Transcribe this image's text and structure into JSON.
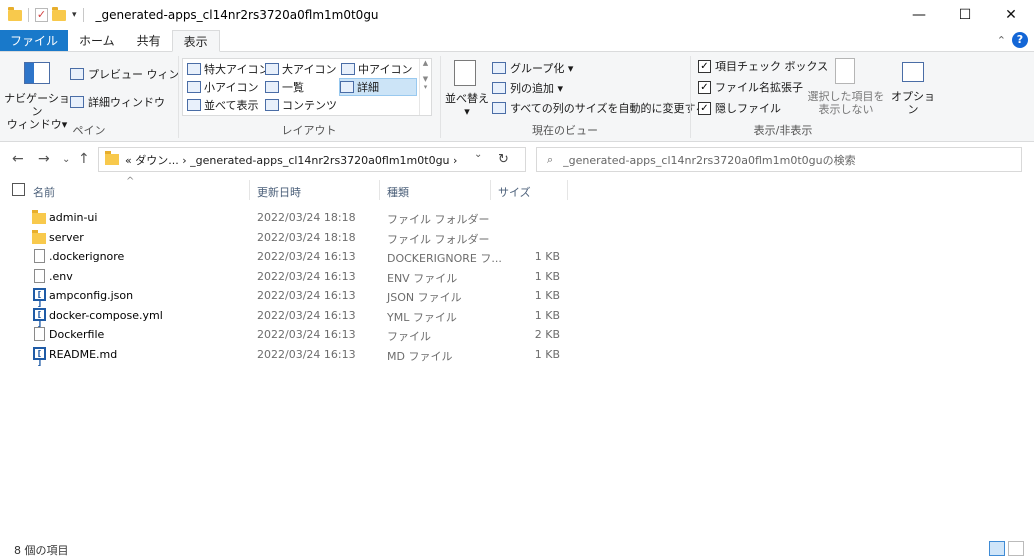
{
  "window": {
    "title": "_generated-apps_cl14nr2rs3720a0flm1m0t0gu",
    "controls": {
      "minimize": "—",
      "maximize": "☐",
      "close": "✕"
    }
  },
  "ribbon_tabs": [
    "ファイル",
    "ホーム",
    "共有",
    "表示"
  ],
  "ribbon": {
    "pane": {
      "nav_pane_label_1": "ナビゲーション",
      "nav_pane_label_2": "ウィンドウ▾",
      "preview": "プレビュー ウィンドウ",
      "details": "詳細ウィンドウ",
      "group_label": "ペイン"
    },
    "layout": {
      "items": [
        "特大アイコン",
        "大アイコン",
        "中アイコン",
        "小アイコン",
        "一覧",
        "詳細",
        "並べて表示",
        "コンテンツ"
      ],
      "selected": "詳細",
      "group_label": "レイアウト"
    },
    "current_view": {
      "sort_label_1": "並べ替え",
      "sort_label_2": "▾",
      "group_by": "グループ化 ▾",
      "add_column": "列の追加 ▾",
      "fit_columns": "すべての列のサイズを自動的に変更する",
      "group_label": "現在のビュー"
    },
    "show_hide": {
      "item_checkbox": "項目チェック ボックス",
      "file_ext": "ファイル名拡張子",
      "hidden_files": "隠しファイル",
      "hide_selected_1": "選択した項目を",
      "hide_selected_2": "表示しない",
      "options": "オプション",
      "group_label": "表示/非表示"
    }
  },
  "address": {
    "path": "« ダウン...  ›  _generated-apps_cl14nr2rs3720a0flm1m0t0gu  ›",
    "search_placeholder": "_generated-apps_cl14nr2rs3720a0flm1m0t0guの検索"
  },
  "columns": {
    "name": "名前",
    "modified": "更新日時",
    "type": "種類",
    "size": "サイズ"
  },
  "files": [
    {
      "name": "admin-ui",
      "modified": "2022/03/24 18:18",
      "type": "ファイル フォルダー",
      "size": "",
      "icon": "folder"
    },
    {
      "name": "server",
      "modified": "2022/03/24 18:18",
      "type": "ファイル フォルダー",
      "size": "",
      "icon": "folder"
    },
    {
      "name": ".dockerignore",
      "modified": "2022/03/24 16:13",
      "type": "DOCKERIGNORE フ...",
      "size": "1 KB",
      "icon": "doc"
    },
    {
      "name": ".env",
      "modified": "2022/03/24 16:13",
      "type": "ENV ファイル",
      "size": "1 KB",
      "icon": "doc"
    },
    {
      "name": "ampconfig.json",
      "modified": "2022/03/24 16:13",
      "type": "JSON ファイル",
      "size": "1 KB",
      "icon": "code"
    },
    {
      "name": "docker-compose.yml",
      "modified": "2022/03/24 16:13",
      "type": "YML ファイル",
      "size": "1 KB",
      "icon": "code"
    },
    {
      "name": "Dockerfile",
      "modified": "2022/03/24 16:13",
      "type": "ファイル",
      "size": "2 KB",
      "icon": "doc"
    },
    {
      "name": "README.md",
      "modified": "2022/03/24 16:13",
      "type": "MD ファイル",
      "size": "1 KB",
      "icon": "code"
    }
  ],
  "status": {
    "count": "8 個の項目"
  }
}
